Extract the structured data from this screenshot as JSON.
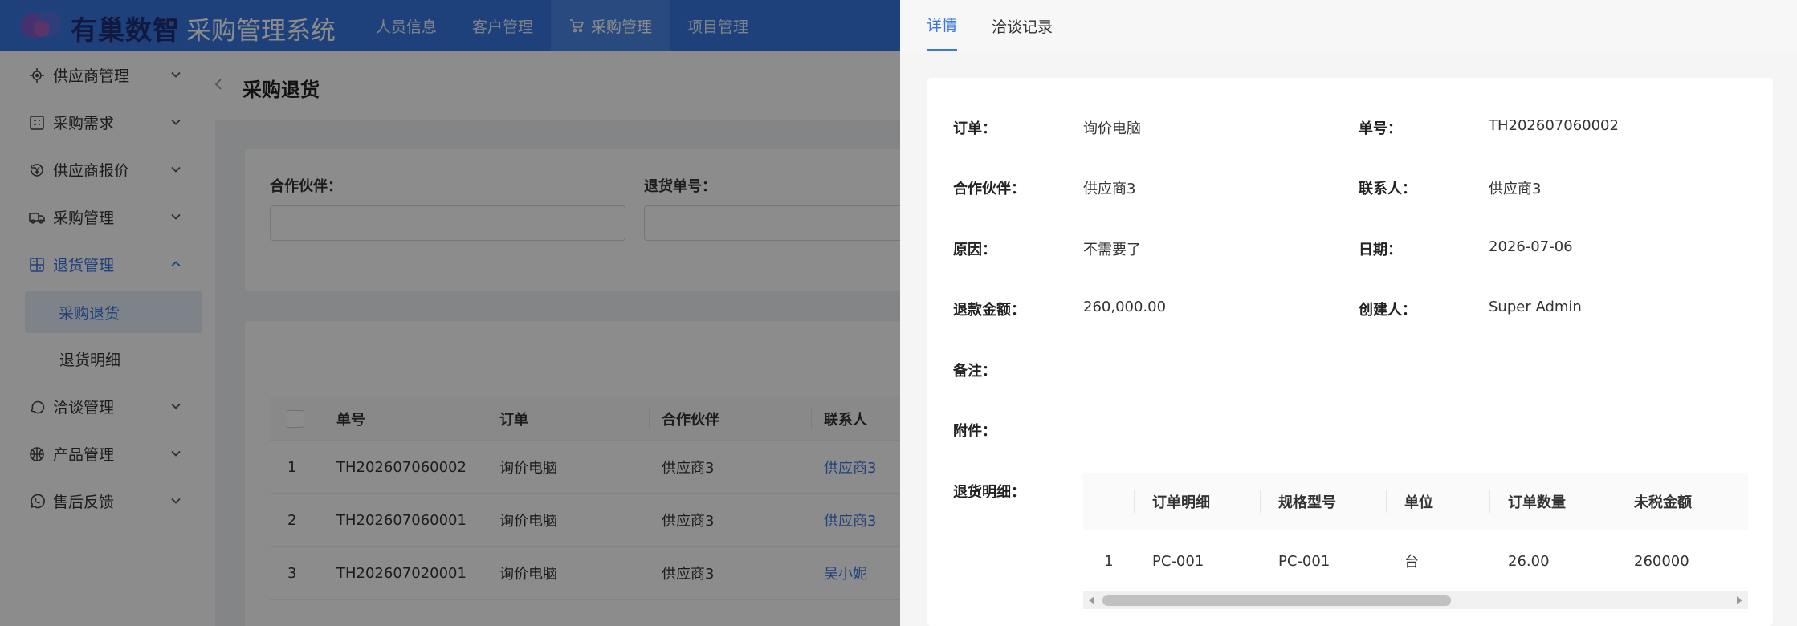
{
  "header": {
    "brand": "有巢数智",
    "system_title": "采购管理系统",
    "nav": [
      {
        "label": "人员信息"
      },
      {
        "label": "客户管理"
      },
      {
        "label": "采购管理",
        "icon": "cart-icon",
        "active": true
      },
      {
        "label": "项目管理"
      }
    ]
  },
  "sidebar": {
    "items": [
      {
        "label": "供应商管理",
        "icon": "target-icon"
      },
      {
        "label": "采购需求",
        "icon": "grid-icon"
      },
      {
        "label": "供应商报价",
        "icon": "currency-icon"
      },
      {
        "label": "采购管理",
        "icon": "truck-icon"
      },
      {
        "label": "退货管理",
        "icon": "return-icon",
        "open": true,
        "children": [
          {
            "label": "采购退货",
            "active": true
          },
          {
            "label": "退货明细"
          }
        ]
      },
      {
        "label": "洽谈管理",
        "icon": "chat-icon"
      },
      {
        "label": "产品管理",
        "icon": "basketball-icon"
      },
      {
        "label": "售后反馈",
        "icon": "phone-icon"
      }
    ]
  },
  "main": {
    "title": "采购退货",
    "filters": {
      "partner_label": "合作伙伴：",
      "return_no_label": "退货单号："
    },
    "table": {
      "columns": [
        "单号",
        "订单",
        "合作伙伴",
        "联系人"
      ],
      "rows": [
        {
          "idx": "1",
          "no": "TH202607060002",
          "order": "询价电脑",
          "partner": "供应商3",
          "contact": "供应商3"
        },
        {
          "idx": "2",
          "no": "TH202607060001",
          "order": "询价电脑",
          "partner": "供应商3",
          "contact": "供应商3"
        },
        {
          "idx": "3",
          "no": "TH202607020001",
          "order": "询价电脑",
          "partner": "供应商3",
          "contact": "吴小妮"
        }
      ]
    }
  },
  "drawer": {
    "tabs": [
      {
        "label": "详情",
        "active": true
      },
      {
        "label": "洽谈记录"
      }
    ],
    "fields": {
      "order_label": "订单：",
      "order": "询价电脑",
      "no_label": "单号：",
      "no": "TH202607060002",
      "partner_label": "合作伙伴：",
      "partner": "供应商3",
      "contact_label": "联系人：",
      "contact": "供应商3",
      "reason_label": "原因：",
      "reason": "不需要了",
      "date_label": "日期：",
      "date": "2026-07-06",
      "refund_label": "退款金额：",
      "refund": "260,000.00",
      "creator_label": "创建人：",
      "creator": "Super Admin",
      "remark_label": "备注：",
      "attachment_label": "附件：",
      "details_label": "退货明细："
    },
    "detail_table": {
      "columns": [
        "订单明细",
        "规格型号",
        "单位",
        "订单数量",
        "未税金额"
      ],
      "rows": [
        {
          "idx": "1",
          "item": "PC-001",
          "spec": "PC-001",
          "unit": "台",
          "qty": "26.00",
          "amount": "260000"
        }
      ]
    }
  },
  "colors": {
    "primary": "#3a77e0",
    "header_bg": "#3a77e0",
    "brand_text": "#1f2f77",
    "overlay": "rgba(0,0,0,0.45)"
  }
}
